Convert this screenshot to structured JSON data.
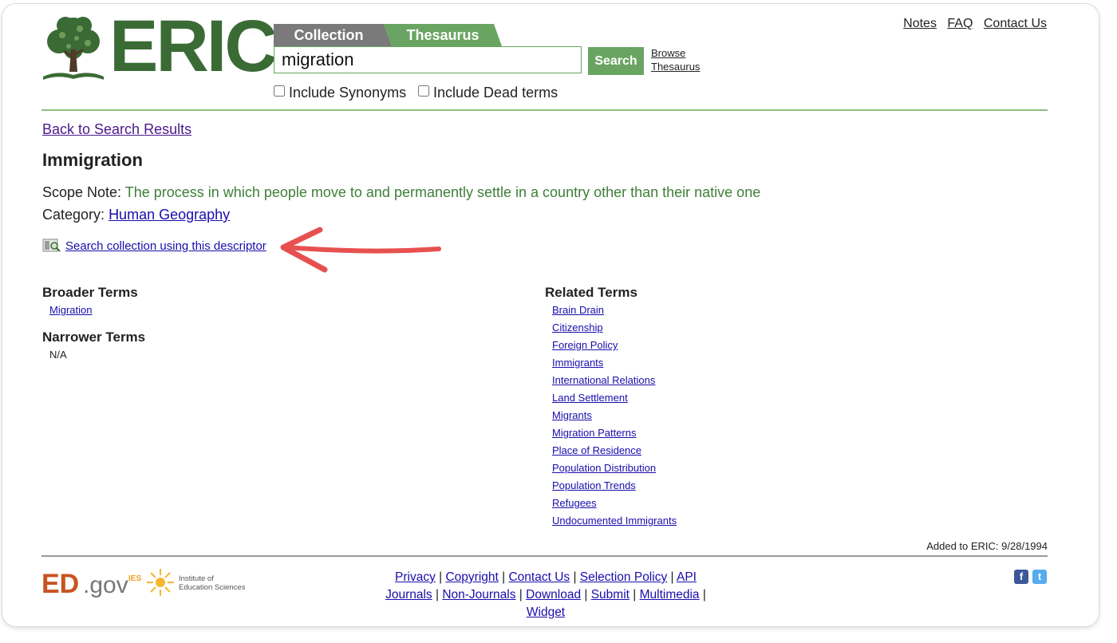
{
  "brand": {
    "logo_text": "ERIC"
  },
  "tabs": {
    "collection": "Collection",
    "thesaurus": "Thesaurus"
  },
  "search": {
    "value": "migration",
    "button": "Search",
    "browse_line1": "Browse",
    "browse_line2": "Thesaurus"
  },
  "options": {
    "synonyms": "Include Synonyms",
    "dead_terms": "Include Dead terms"
  },
  "toplinks": [
    "Notes",
    "FAQ",
    "Contact Us"
  ],
  "back_link": "Back to Search Results",
  "term": {
    "title": "Immigration",
    "scope_label": "Scope Note:",
    "scope_value": "The process in which people move to and permanently settle in a country other than their native one",
    "category_label": "Category:",
    "category_value": "Human Geography",
    "search_descriptor": "Search collection using this descriptor"
  },
  "broader": {
    "heading": "Broader Terms",
    "items": [
      "Migration"
    ]
  },
  "narrower": {
    "heading": "Narrower Terms",
    "value": "N/A"
  },
  "related": {
    "heading": "Related Terms",
    "items": [
      "Brain Drain",
      "Citizenship",
      "Foreign Policy",
      "Immigrants",
      "International Relations",
      "Land Settlement",
      "Migrants",
      "Migration Patterns",
      "Place of Residence",
      "Population Distribution",
      "Population Trends",
      "Refugees",
      "Undocumented Immigrants"
    ]
  },
  "added": "Added to ERIC: 9/28/1994",
  "footer": {
    "edgov_ed": "ED",
    "edgov_gov": ".gov",
    "ies": "IES",
    "ies_line1": "Institute of",
    "ies_line2": "Education Sciences",
    "row1": [
      "Privacy",
      "Copyright",
      "Contact Us",
      "Selection Policy",
      "API"
    ],
    "row2": [
      "Journals",
      "Non-Journals",
      "Download",
      "Submit",
      "Multimedia",
      "Widget"
    ]
  },
  "social": {
    "facebook": "f",
    "twitter": "t"
  },
  "colors": {
    "brand_green": "#3a6b35",
    "accent_green": "#6aa462",
    "link": "#1a0dab",
    "annotation_arrow": "#e85050"
  }
}
